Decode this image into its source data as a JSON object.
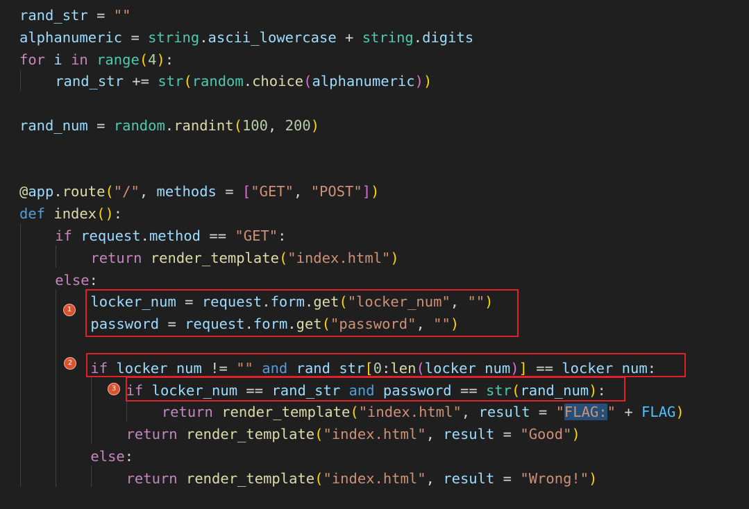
{
  "code_lines": [
    {
      "indent": 0,
      "tokens": [
        {
          "t": "rand_str",
          "c": "#9cdcfe"
        },
        {
          "t": " = ",
          "c": "#d4d4d4"
        },
        {
          "t": "\"\"",
          "c": "#ce9178"
        }
      ]
    },
    {
      "indent": 0,
      "tokens": [
        {
          "t": "alphanumeric",
          "c": "#9cdcfe"
        },
        {
          "t": " = ",
          "c": "#d4d4d4"
        },
        {
          "t": "string",
          "c": "#4ec9b0"
        },
        {
          "t": ".",
          "c": "#d4d4d4"
        },
        {
          "t": "ascii_lowercase",
          "c": "#9cdcfe"
        },
        {
          "t": " + ",
          "c": "#d4d4d4"
        },
        {
          "t": "string",
          "c": "#4ec9b0"
        },
        {
          "t": ".",
          "c": "#d4d4d4"
        },
        {
          "t": "digits",
          "c": "#9cdcfe"
        }
      ]
    },
    {
      "indent": 0,
      "tokens": [
        {
          "t": "for",
          "c": "#c586c0"
        },
        {
          "t": " ",
          "c": "#d4d4d4"
        },
        {
          "t": "i",
          "c": "#9cdcfe"
        },
        {
          "t": " ",
          "c": "#d4d4d4"
        },
        {
          "t": "in",
          "c": "#c586c0"
        },
        {
          "t": " ",
          "c": "#d4d4d4"
        },
        {
          "t": "range",
          "c": "#4ec9b0"
        },
        {
          "t": "(",
          "c": "#ffd700"
        },
        {
          "t": "4",
          "c": "#b5cea8"
        },
        {
          "t": ")",
          "c": "#ffd700"
        },
        {
          "t": ":",
          "c": "#d4d4d4"
        }
      ]
    },
    {
      "indent": 1,
      "tokens": [
        {
          "t": "rand_str",
          "c": "#9cdcfe"
        },
        {
          "t": " += ",
          "c": "#d4d4d4"
        },
        {
          "t": "str",
          "c": "#4ec9b0"
        },
        {
          "t": "(",
          "c": "#ffd700"
        },
        {
          "t": "random",
          "c": "#4ec9b0"
        },
        {
          "t": ".",
          "c": "#d4d4d4"
        },
        {
          "t": "choice",
          "c": "#dcdcaa"
        },
        {
          "t": "(",
          "c": "#da70d6"
        },
        {
          "t": "alphanumeric",
          "c": "#9cdcfe"
        },
        {
          "t": ")",
          "c": "#da70d6"
        },
        {
          "t": ")",
          "c": "#ffd700"
        }
      ]
    },
    {
      "indent": 0,
      "tokens": []
    },
    {
      "indent": 0,
      "tokens": [
        {
          "t": "rand_num",
          "c": "#9cdcfe"
        },
        {
          "t": " = ",
          "c": "#d4d4d4"
        },
        {
          "t": "random",
          "c": "#4ec9b0"
        },
        {
          "t": ".",
          "c": "#d4d4d4"
        },
        {
          "t": "randint",
          "c": "#dcdcaa"
        },
        {
          "t": "(",
          "c": "#ffd700"
        },
        {
          "t": "100",
          "c": "#b5cea8"
        },
        {
          "t": ", ",
          "c": "#d4d4d4"
        },
        {
          "t": "200",
          "c": "#b5cea8"
        },
        {
          "t": ")",
          "c": "#ffd700"
        }
      ]
    },
    {
      "indent": 0,
      "tokens": []
    },
    {
      "indent": 0,
      "tokens": []
    },
    {
      "indent": 0,
      "tokens": [
        {
          "t": "@",
          "c": "#dcdcaa"
        },
        {
          "t": "app",
          "c": "#9cdcfe"
        },
        {
          "t": ".",
          "c": "#d4d4d4"
        },
        {
          "t": "route",
          "c": "#dcdcaa"
        },
        {
          "t": "(",
          "c": "#ffd700"
        },
        {
          "t": "\"/\"",
          "c": "#ce9178"
        },
        {
          "t": ", ",
          "c": "#d4d4d4"
        },
        {
          "t": "methods",
          "c": "#9cdcfe"
        },
        {
          "t": " = ",
          "c": "#d4d4d4"
        },
        {
          "t": "[",
          "c": "#da70d6"
        },
        {
          "t": "\"GET\"",
          "c": "#ce9178"
        },
        {
          "t": ", ",
          "c": "#d4d4d4"
        },
        {
          "t": "\"POST\"",
          "c": "#ce9178"
        },
        {
          "t": "]",
          "c": "#da70d6"
        },
        {
          "t": ")",
          "c": "#ffd700"
        }
      ]
    },
    {
      "indent": 0,
      "tokens": [
        {
          "t": "def",
          "c": "#569cd6"
        },
        {
          "t": " ",
          "c": "#d4d4d4"
        },
        {
          "t": "index",
          "c": "#dcdcaa"
        },
        {
          "t": "(",
          "c": "#ffd700"
        },
        {
          "t": ")",
          "c": "#ffd700"
        },
        {
          "t": ":",
          "c": "#d4d4d4"
        }
      ]
    },
    {
      "indent": 1,
      "tokens": [
        {
          "t": "if",
          "c": "#c586c0"
        },
        {
          "t": " ",
          "c": "#d4d4d4"
        },
        {
          "t": "request",
          "c": "#9cdcfe"
        },
        {
          "t": ".",
          "c": "#d4d4d4"
        },
        {
          "t": "method",
          "c": "#9cdcfe"
        },
        {
          "t": " == ",
          "c": "#d4d4d4"
        },
        {
          "t": "\"GET\"",
          "c": "#ce9178"
        },
        {
          "t": ":",
          "c": "#d4d4d4"
        }
      ]
    },
    {
      "indent": 2,
      "tokens": [
        {
          "t": "return",
          "c": "#c586c0"
        },
        {
          "t": " ",
          "c": "#d4d4d4"
        },
        {
          "t": "render_template",
          "c": "#dcdcaa"
        },
        {
          "t": "(",
          "c": "#ffd700"
        },
        {
          "t": "\"index.html\"",
          "c": "#ce9178"
        },
        {
          "t": ")",
          "c": "#ffd700"
        }
      ]
    },
    {
      "indent": 1,
      "tokens": [
        {
          "t": "else",
          "c": "#c586c0"
        },
        {
          "t": ":",
          "c": "#d4d4d4"
        }
      ]
    },
    {
      "indent": 2,
      "tokens": [
        {
          "t": "locker_num",
          "c": "#9cdcfe"
        },
        {
          "t": " = ",
          "c": "#d4d4d4"
        },
        {
          "t": "request",
          "c": "#9cdcfe"
        },
        {
          "t": ".",
          "c": "#d4d4d4"
        },
        {
          "t": "form",
          "c": "#9cdcfe"
        },
        {
          "t": ".",
          "c": "#d4d4d4"
        },
        {
          "t": "get",
          "c": "#dcdcaa"
        },
        {
          "t": "(",
          "c": "#ffd700"
        },
        {
          "t": "\"locker_num\"",
          "c": "#ce9178"
        },
        {
          "t": ", ",
          "c": "#d4d4d4"
        },
        {
          "t": "\"\"",
          "c": "#ce9178"
        },
        {
          "t": ")",
          "c": "#ffd700"
        }
      ]
    },
    {
      "indent": 2,
      "tokens": [
        {
          "t": "password",
          "c": "#9cdcfe"
        },
        {
          "t": " = ",
          "c": "#d4d4d4"
        },
        {
          "t": "request",
          "c": "#9cdcfe"
        },
        {
          "t": ".",
          "c": "#d4d4d4"
        },
        {
          "t": "form",
          "c": "#9cdcfe"
        },
        {
          "t": ".",
          "c": "#d4d4d4"
        },
        {
          "t": "get",
          "c": "#dcdcaa"
        },
        {
          "t": "(",
          "c": "#ffd700"
        },
        {
          "t": "\"password\"",
          "c": "#ce9178"
        },
        {
          "t": ", ",
          "c": "#d4d4d4"
        },
        {
          "t": "\"\"",
          "c": "#ce9178"
        },
        {
          "t": ")",
          "c": "#ffd700"
        }
      ]
    },
    {
      "indent": 0,
      "tokens": []
    },
    {
      "indent": 2,
      "tokens": [
        {
          "t": "if",
          "c": "#c586c0"
        },
        {
          "t": " ",
          "c": "#d4d4d4"
        },
        {
          "t": "locker_num",
          "c": "#9cdcfe"
        },
        {
          "t": " != ",
          "c": "#d4d4d4"
        },
        {
          "t": "\"\"",
          "c": "#ce9178"
        },
        {
          "t": " ",
          "c": "#d4d4d4"
        },
        {
          "t": "and",
          "c": "#569cd6"
        },
        {
          "t": " ",
          "c": "#d4d4d4"
        },
        {
          "t": "rand_str",
          "c": "#9cdcfe"
        },
        {
          "t": "[",
          "c": "#ffd700"
        },
        {
          "t": "0",
          "c": "#b5cea8"
        },
        {
          "t": ":",
          "c": "#d4d4d4"
        },
        {
          "t": "len",
          "c": "#dcdcaa"
        },
        {
          "t": "(",
          "c": "#da70d6"
        },
        {
          "t": "locker_num",
          "c": "#9cdcfe"
        },
        {
          "t": ")",
          "c": "#da70d6"
        },
        {
          "t": "]",
          "c": "#ffd700"
        },
        {
          "t": " == ",
          "c": "#d4d4d4"
        },
        {
          "t": "locker_num",
          "c": "#9cdcfe"
        },
        {
          "t": ":",
          "c": "#d4d4d4"
        }
      ]
    },
    {
      "indent": 3,
      "tokens": [
        {
          "t": "if",
          "c": "#c586c0"
        },
        {
          "t": " ",
          "c": "#d4d4d4"
        },
        {
          "t": "locker_num",
          "c": "#9cdcfe"
        },
        {
          "t": " == ",
          "c": "#d4d4d4"
        },
        {
          "t": "rand_str",
          "c": "#9cdcfe"
        },
        {
          "t": " ",
          "c": "#d4d4d4"
        },
        {
          "t": "and",
          "c": "#569cd6"
        },
        {
          "t": " ",
          "c": "#d4d4d4"
        },
        {
          "t": "password",
          "c": "#9cdcfe"
        },
        {
          "t": " == ",
          "c": "#d4d4d4"
        },
        {
          "t": "str",
          "c": "#4ec9b0"
        },
        {
          "t": "(",
          "c": "#ffd700"
        },
        {
          "t": "rand_num",
          "c": "#9cdcfe"
        },
        {
          "t": ")",
          "c": "#ffd700"
        },
        {
          "t": ":",
          "c": "#d4d4d4"
        }
      ]
    },
    {
      "indent": 4,
      "tokens": [
        {
          "t": "return",
          "c": "#c586c0"
        },
        {
          "t": " ",
          "c": "#d4d4d4"
        },
        {
          "t": "render_template",
          "c": "#dcdcaa"
        },
        {
          "t": "(",
          "c": "#ffd700"
        },
        {
          "t": "\"index.html\"",
          "c": "#ce9178"
        },
        {
          "t": ", ",
          "c": "#d4d4d4"
        },
        {
          "t": "result",
          "c": "#9cdcfe"
        },
        {
          "t": " = ",
          "c": "#d4d4d4"
        },
        {
          "t": "\"",
          "c": "#ce9178"
        },
        {
          "t": "FLAG:",
          "c": "#ce9178",
          "hl": true
        },
        {
          "t": "\"",
          "c": "#ce9178"
        },
        {
          "t": " + ",
          "c": "#d4d4d4"
        },
        {
          "t": "FLAG",
          "c": "#4fc1ff"
        },
        {
          "t": ")",
          "c": "#ffd700"
        }
      ]
    },
    {
      "indent": 3,
      "tokens": [
        {
          "t": "return",
          "c": "#c586c0"
        },
        {
          "t": " ",
          "c": "#d4d4d4"
        },
        {
          "t": "render_template",
          "c": "#dcdcaa"
        },
        {
          "t": "(",
          "c": "#ffd700"
        },
        {
          "t": "\"index.html\"",
          "c": "#ce9178"
        },
        {
          "t": ", ",
          "c": "#d4d4d4"
        },
        {
          "t": "result",
          "c": "#9cdcfe"
        },
        {
          "t": " = ",
          "c": "#d4d4d4"
        },
        {
          "t": "\"Good\"",
          "c": "#ce9178"
        },
        {
          "t": ")",
          "c": "#ffd700"
        }
      ]
    },
    {
      "indent": 2,
      "tokens": [
        {
          "t": "else",
          "c": "#c586c0"
        },
        {
          "t": ":",
          "c": "#d4d4d4"
        }
      ]
    },
    {
      "indent": 3,
      "tokens": [
        {
          "t": "return",
          "c": "#c586c0"
        },
        {
          "t": " ",
          "c": "#d4d4d4"
        },
        {
          "t": "render_template",
          "c": "#dcdcaa"
        },
        {
          "t": "(",
          "c": "#ffd700"
        },
        {
          "t": "\"index.html\"",
          "c": "#ce9178"
        },
        {
          "t": ", ",
          "c": "#d4d4d4"
        },
        {
          "t": "result",
          "c": "#9cdcfe"
        },
        {
          "t": " = ",
          "c": "#d4d4d4"
        },
        {
          "t": "\"Wrong!\"",
          "c": "#ce9178"
        },
        {
          "t": ")",
          "c": "#ffd700"
        }
      ]
    }
  ],
  "annotations": [
    {
      "label": "1",
      "color": "#e0202a"
    },
    {
      "label": "2",
      "color": "#e0202a"
    },
    {
      "label": "3",
      "color": "#e0202a"
    }
  ]
}
